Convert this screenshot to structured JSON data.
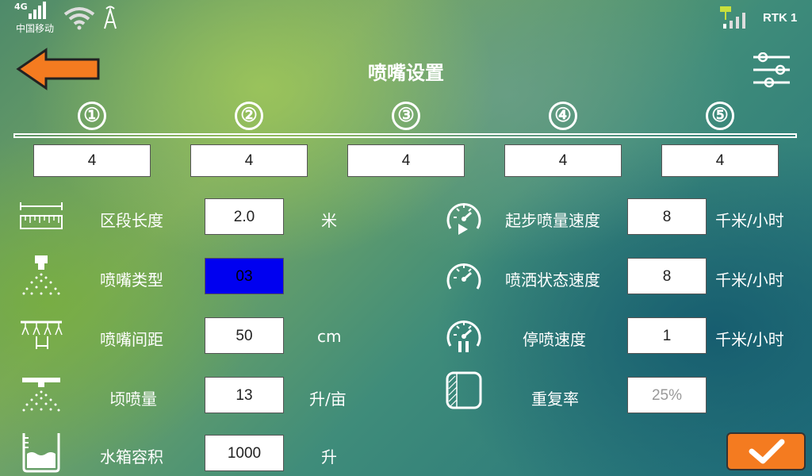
{
  "status_bar": {
    "network": "4G",
    "carrier": "中国移动",
    "rtk_label": "RTK 1"
  },
  "header": {
    "title": "喷嘴设置",
    "back_icon": "back-arrow-icon",
    "menu_icon": "sliders-icon"
  },
  "zones": [
    {
      "number": "①",
      "value": "4"
    },
    {
      "number": "②",
      "value": "4"
    },
    {
      "number": "③",
      "value": "4"
    },
    {
      "number": "④",
      "value": "4"
    },
    {
      "number": "⑤",
      "value": "4"
    }
  ],
  "left_settings": [
    {
      "icon": "ruler-icon",
      "label": "区段长度",
      "value": "2.0",
      "unit": "米"
    },
    {
      "icon": "nozzle-icon",
      "label": "喷嘴类型",
      "value": "03",
      "unit": ""
    },
    {
      "icon": "boom-icon",
      "label": "喷嘴间距",
      "value": "50",
      "unit": "cm"
    },
    {
      "icon": "spray-icon",
      "label": "顷喷量",
      "value": "13",
      "unit": "升/亩"
    },
    {
      "icon": "tank-icon",
      "label": "水箱容积",
      "value": "1000",
      "unit": "升"
    }
  ],
  "right_settings": [
    {
      "icon": "speedometer-play-icon",
      "label": "起步喷量速度",
      "value": "8",
      "unit": "千米/小时"
    },
    {
      "icon": "speedometer-icon",
      "label": "喷洒状态速度",
      "value": "8",
      "unit": "千米/小时"
    },
    {
      "icon": "speedometer-pause-icon",
      "label": "停喷速度",
      "value": "1",
      "unit": "千米/小时"
    },
    {
      "icon": "overlap-icon",
      "label": "重复率",
      "value": "25%",
      "unit": ""
    }
  ],
  "confirm_icon": "checkmark-icon",
  "colors": {
    "accent": "#f47b20",
    "selected": "#0000f0"
  }
}
